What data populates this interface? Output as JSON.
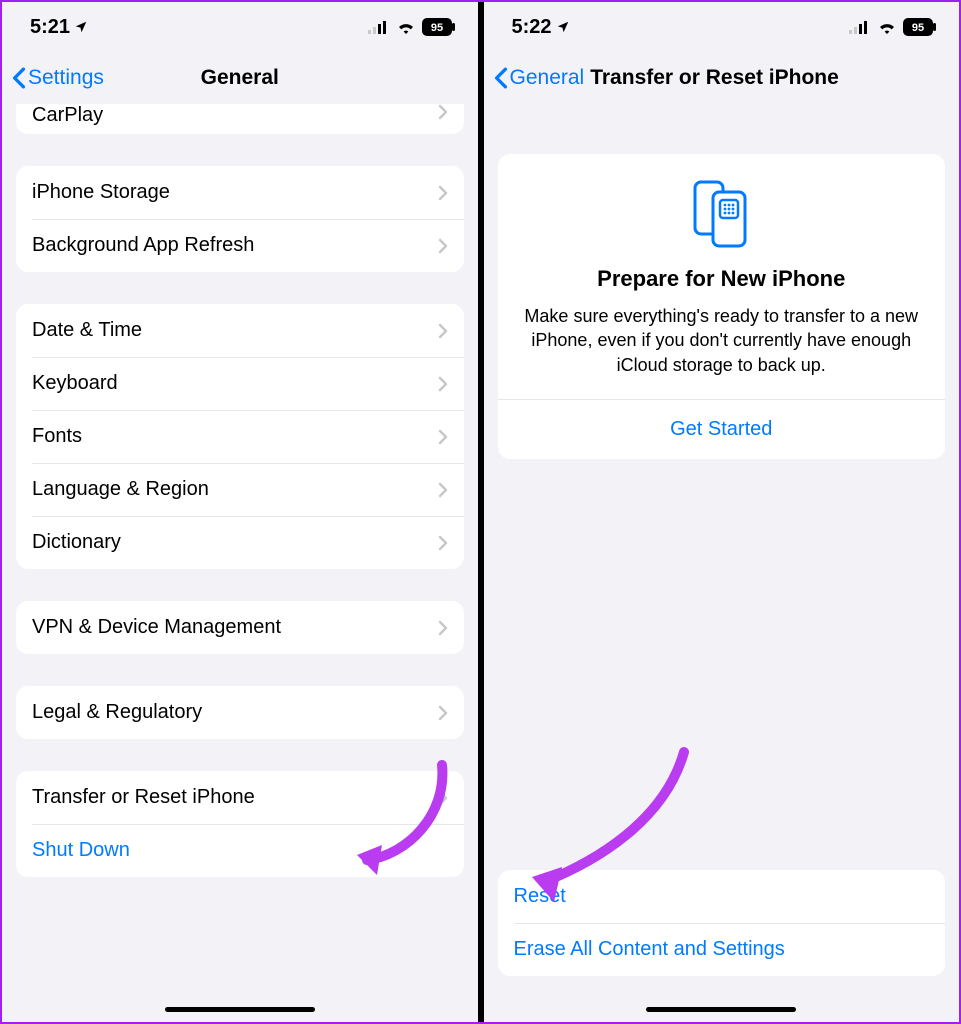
{
  "left": {
    "status": {
      "time": "5:21",
      "battery": "95"
    },
    "nav": {
      "back": "Settings",
      "title": "General"
    },
    "groups": {
      "g0": {
        "carplay": "CarPlay"
      },
      "g1": {
        "storage": "iPhone Storage",
        "bg": "Background App Refresh"
      },
      "g2": {
        "date": "Date & Time",
        "keyboard": "Keyboard",
        "fonts": "Fonts",
        "lang": "Language & Region",
        "dict": "Dictionary"
      },
      "g3": {
        "vpn": "VPN & Device Management"
      },
      "g4": {
        "legal": "Legal & Regulatory"
      },
      "g5": {
        "transfer": "Transfer or Reset iPhone",
        "shutdown": "Shut Down"
      }
    }
  },
  "right": {
    "status": {
      "time": "5:22",
      "battery": "95"
    },
    "nav": {
      "back": "General",
      "title": "Transfer or Reset iPhone"
    },
    "card": {
      "title": "Prepare for New iPhone",
      "desc": "Make sure everything's ready to transfer to a new iPhone, even if you don't currently have enough iCloud storage to back up.",
      "action": "Get Started"
    },
    "bottom": {
      "reset": "Reset",
      "erase": "Erase All Content and Settings"
    }
  }
}
